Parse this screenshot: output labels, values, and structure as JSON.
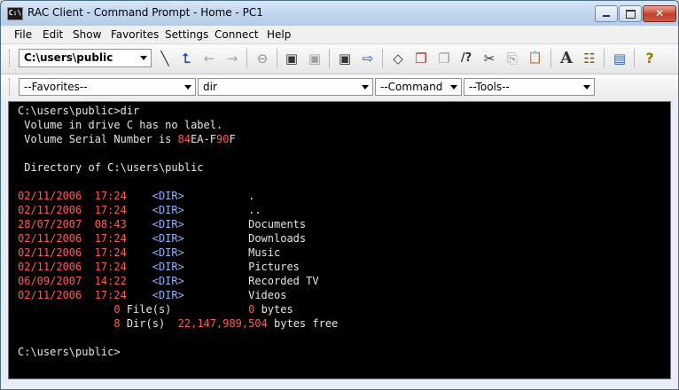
{
  "window": {
    "title": "RAC Client - Command Prompt - Home - PC1",
    "app_icon_text": "C:\\",
    "controls": {
      "minimize": "minimize",
      "maximize": "maximize",
      "close": "✕"
    }
  },
  "menu": [
    "File",
    "Edit",
    "Show",
    "Favorites",
    "Settings",
    "Connect",
    "Help"
  ],
  "toolbar": {
    "path_value": "C:\\users\\public",
    "icons": [
      "backslash-icon",
      "up-folder-icon",
      "back-arrow-icon",
      "forward-arrow-icon",
      "stop-icon",
      "save-icon",
      "save-disabled-icon",
      "save-as-icon",
      "send-icon",
      "eraser-icon",
      "copy-doc-icon",
      "paste-doc-icon",
      "find-help-icon",
      "cut-icon",
      "copy-icon",
      "paste-icon",
      "font-icon",
      "options-icon",
      "network-icon",
      "help-icon"
    ],
    "glyphs": {
      "backslash": "╲",
      "up": "⮤",
      "back": "←",
      "forward": "→",
      "stop": "⊖",
      "save": "▣",
      "save2": "▣",
      "saveas": "▣",
      "send": "⇨",
      "eraser": "◇",
      "copydoc": "❐",
      "pastedoc": "❐",
      "findhelp": "/?",
      "cut": "✂",
      "copy": "⎘",
      "paste": "📋",
      "font": "A",
      "options": "☷",
      "network": "▤",
      "help": "?"
    }
  },
  "toolbar2": {
    "favorites": "--Favorites--",
    "command_input": "dir",
    "command": "--Command",
    "tools": "--Tools--"
  },
  "console": {
    "prompt1": "C:\\users\\public>dir",
    "vol_label": " Volume in drive C has no label.",
    "serial_prefix": " Volume Serial Number is ",
    "serial_a": "84",
    "serial_b": "EA-F",
    "serial_c": "90",
    "serial_d": "F",
    "dir_of": " Directory of C:\\users\\public",
    "entries": [
      {
        "date": "02/11/2006",
        "time": "17:24",
        "type": "<DIR>",
        "name": "."
      },
      {
        "date": "02/11/2006",
        "time": "17:24",
        "type": "<DIR>",
        "name": ".."
      },
      {
        "date": "28/07/2007",
        "time": "08:43",
        "type": "<DIR>",
        "name": "Documents"
      },
      {
        "date": "02/11/2006",
        "time": "17:24",
        "type": "<DIR>",
        "name": "Downloads"
      },
      {
        "date": "02/11/2006",
        "time": "17:24",
        "type": "<DIR>",
        "name": "Music"
      },
      {
        "date": "02/11/2006",
        "time": "17:24",
        "type": "<DIR>",
        "name": "Pictures"
      },
      {
        "date": "06/09/2007",
        "time": "14:22",
        "type": "<DIR>",
        "name": "Recorded TV"
      },
      {
        "date": "02/11/2006",
        "time": "17:24",
        "type": "<DIR>",
        "name": "Videos"
      }
    ],
    "files_count": "0",
    "files_label": " File(s)",
    "files_bytes": "0",
    "bytes_label": " bytes",
    "dirs_count": "8",
    "dirs_label": " Dir(s)",
    "free_bytes": "22,147,989,504",
    "free_label": " bytes free",
    "prompt2": "C:\\users\\public>"
  }
}
